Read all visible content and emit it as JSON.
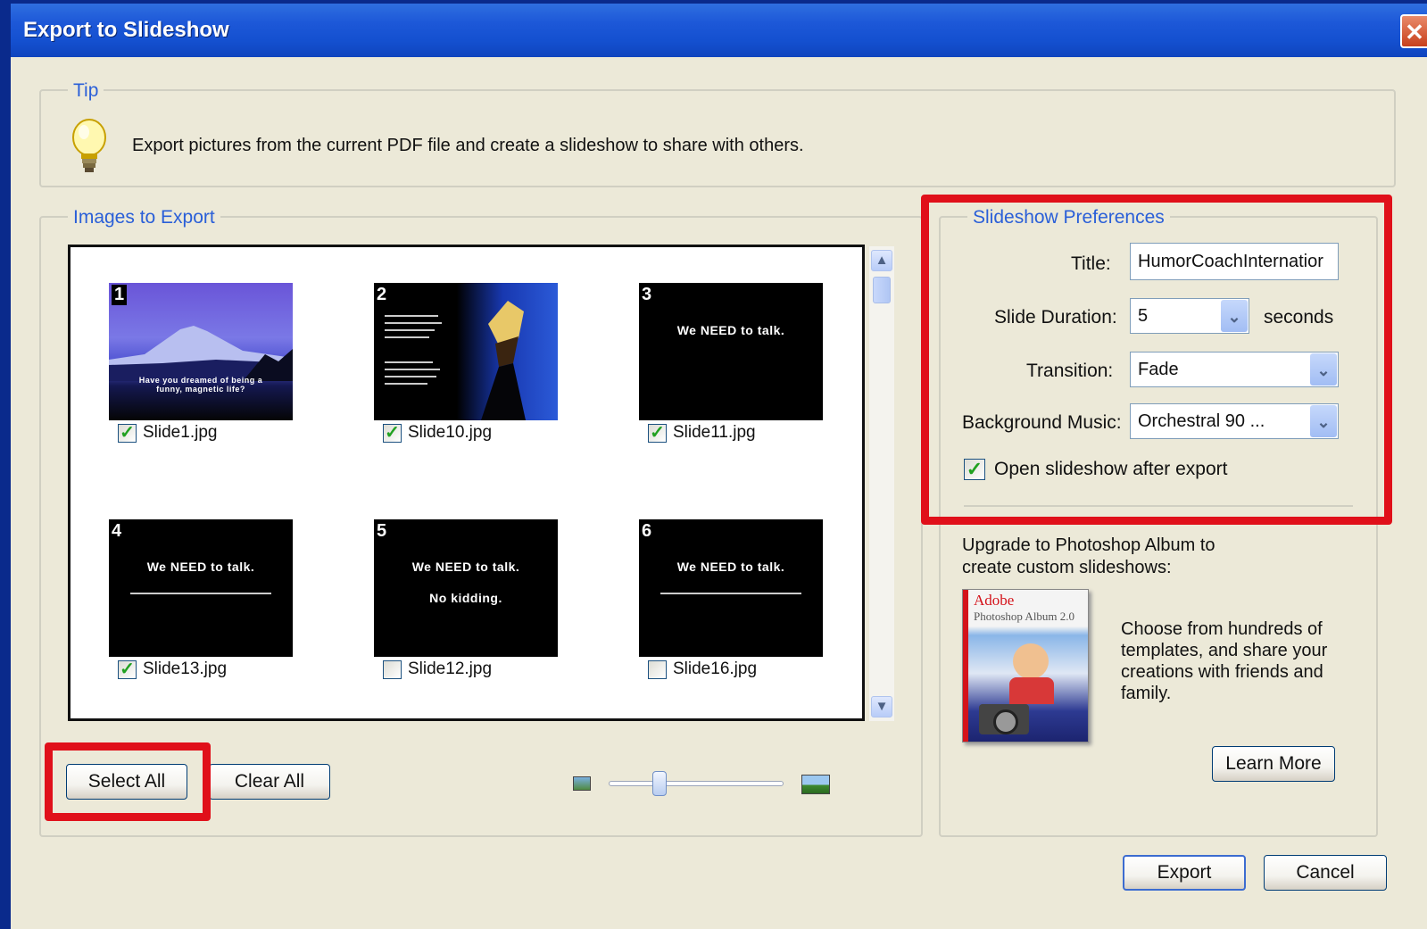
{
  "window": {
    "title": "Export to Slideshow",
    "close_glyph": "✕"
  },
  "tip": {
    "legend": "Tip",
    "text": "Export pictures from the current PDF file and create a slideshow to share with others.",
    "icon": "lightbulb-icon"
  },
  "images": {
    "legend": "Images to Export",
    "items": [
      {
        "num": "1",
        "file": "Slide1.jpg",
        "checked": true,
        "caption": "Have you dreamed of being a funny, magnetic life?"
      },
      {
        "num": "2",
        "file": "Slide10.jpg",
        "checked": true,
        "caption": ""
      },
      {
        "num": "3",
        "file": "Slide11.jpg",
        "checked": true,
        "caption": "We NEED to talk."
      },
      {
        "num": "4",
        "file": "Slide13.jpg",
        "checked": true,
        "caption": "We NEED to talk."
      },
      {
        "num": "5",
        "file": "Slide12.jpg",
        "checked": false,
        "caption": "We NEED to talk.",
        "caption2": "No kidding."
      },
      {
        "num": "6",
        "file": "Slide16.jpg",
        "checked": false,
        "caption": "We NEED to talk."
      }
    ],
    "select_all": "Select All",
    "clear_all": "Clear All",
    "zoom_level": 0.27
  },
  "prefs": {
    "legend": "Slideshow Preferences",
    "title_label": "Title:",
    "title_value": "HumorCoachInternatior",
    "duration_label": "Slide Duration:",
    "duration_value": "5",
    "duration_unit": "seconds",
    "transition_label": "Transition:",
    "transition_value": "Fade",
    "music_label": "Background Music:",
    "music_value": "Orchestral 90 ...",
    "open_after_label": "Open slideshow after export",
    "open_after_checked": true
  },
  "upgrade": {
    "heading_line1": "Upgrade to Photoshop Album to",
    "heading_line2": "create custom slideshows:",
    "box_brand": "Adobe",
    "box_product": "Photoshop Album 2.0",
    "desc_line1": "Choose from hundreds of",
    "desc_line2": "templates, and share your",
    "desc_line3": "creations with friends and",
    "desc_line4": "family.",
    "learn_more": "Learn More"
  },
  "footer": {
    "export": "Export",
    "cancel": "Cancel"
  },
  "colors": {
    "accent_red": "#e0101a",
    "legend_blue": "#2a5fd8",
    "titlebar_blue": "#1d58d8"
  }
}
